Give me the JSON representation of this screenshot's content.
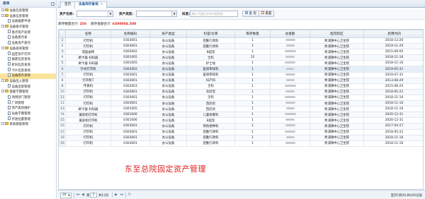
{
  "sidebar": {
    "title": "菜单",
    "items": [
      {
        "label": "设备信息管理",
        "level": 0,
        "type": "folder"
      },
      {
        "label": "设备信息管理",
        "level": 0,
        "type": "folder"
      },
      {
        "label": "设备报废申请",
        "level": 1,
        "type": "doc"
      },
      {
        "label": "设备盘点管理",
        "level": 0,
        "type": "folder"
      },
      {
        "label": "盘点资产处理",
        "level": 1,
        "type": "doc"
      },
      {
        "label": "设备盘点表",
        "level": 1,
        "type": "doc"
      },
      {
        "label": "设备资产盘点",
        "level": 1,
        "type": "doc"
      },
      {
        "label": "设备查询管理",
        "level": 0,
        "type": "folder"
      },
      {
        "label": "固定资产打印",
        "level": 1,
        "type": "doc"
      },
      {
        "label": "报废信息查询",
        "level": 1,
        "type": "doc"
      },
      {
        "label": "折旧信息查询",
        "level": 1,
        "type": "doc"
      },
      {
        "label": "卡片信息查询",
        "level": 1,
        "type": "doc"
      },
      {
        "label": "设备库存查询",
        "level": 1,
        "type": "doc",
        "selected": true
      },
      {
        "label": "设备出入管理",
        "level": 0,
        "type": "folder"
      },
      {
        "label": "设备出库管理",
        "level": 1,
        "type": "doc"
      },
      {
        "label": "基础字典管理",
        "level": 0,
        "type": "folder"
      },
      {
        "label": "领用部门管理",
        "level": 1,
        "type": "doc"
      },
      {
        "label": "厂商管理",
        "level": 1,
        "type": "doc"
      },
      {
        "label": "资产类别维护",
        "level": 1,
        "type": "doc"
      },
      {
        "label": "设备字典管理",
        "level": 1,
        "type": "doc"
      },
      {
        "label": "存放位置管理",
        "level": 1,
        "type": "doc"
      },
      {
        "label": "系统基础管理",
        "level": 0,
        "type": "folder"
      }
    ]
  },
  "tabs": [
    {
      "label": "首页",
      "active": false
    },
    {
      "label": "设备库存查询",
      "active": true,
      "close": "×"
    }
  ],
  "search": {
    "asset_name_label": "资产名称:",
    "asset_type_label": "资产类型:",
    "keyword_label": "科室:",
    "keyword_placeholder": "输入不超过字符内容搜索",
    "dropdown_arrow": "▼",
    "search_button": "查 询",
    "reset_button": "重置"
  },
  "stats": {
    "total_label": "库存数量合计:",
    "total_value": "256",
    "amount_label": "库存金额合计:",
    "amount_value": "6300004.580"
  },
  "table": {
    "columns": [
      "名称",
      "名称编码",
      "资产类型",
      "科室/仓库",
      "库存数量",
      "总金额",
      "医院院区",
      "启用时间"
    ],
    "rows": [
      [
        "打印机",
        "0303001",
        "办公设备",
        "后勤行政科",
        "1",
        "",
        "青浦镇中心卫生院",
        "2018-12-20"
      ],
      [
        "打印机",
        "0303001",
        "办公设备",
        "后勤行政科",
        "1",
        "",
        "青浦镇中心卫生院",
        "2019-11-29"
      ],
      [
        "电脑桌椅",
        "0302002",
        "办公设备",
        "B超室",
        "1",
        "",
        "青浦镇中心卫生院",
        "2015-09-05"
      ],
      [
        "刷卡器 扫码器",
        "0301005",
        "办公设备",
        "全科",
        "15",
        "",
        "青浦镇中心卫生院",
        "2018-11-16"
      ],
      [
        "刷卡器 扫码器",
        "0301005",
        "办公设备",
        "护士站",
        "1",
        "",
        "青浦镇中心卫生院",
        "2018-11-16"
      ],
      [
        "针式打印机",
        "0303002",
        "办公设备",
        "医保审核科",
        "1",
        "",
        "青浦镇中心卫生院",
        "2019-05-31"
      ],
      [
        "打印机",
        "0303001",
        "办公设备",
        "医保审核科",
        "1",
        "",
        "青浦镇中心卫生院",
        "2019-07-31"
      ],
      [
        "打印机T",
        "0303001",
        "办公设备",
        "妇产科",
        "1",
        "",
        "青浦镇中心卫生院",
        "2013-08-29"
      ],
      [
        "传真机",
        "0302003",
        "办公设备",
        "全科",
        "1",
        "",
        "青浦镇中心卫生院",
        "2015-08-25"
      ],
      [
        "打印机",
        "0303001",
        "办公设备",
        "化验室",
        "1",
        "",
        "青浦镇中心卫生院",
        "2018-05-22"
      ],
      [
        "打印机",
        "0303001",
        "办公设备",
        "全科",
        "1",
        "",
        "青浦镇中心卫生院",
        "2018-11-16"
      ],
      [
        "打印机",
        "0303001",
        "办公设备",
        "西药房",
        "1",
        "",
        "青浦镇中心卫生院",
        "2018-11-16"
      ],
      [
        "刷卡器 扫码器",
        "0301005",
        "办公设备",
        "西药房",
        "1",
        "",
        "青浦镇中心卫生院",
        "2018-11-16"
      ],
      [
        "兼容机打印机",
        "0301006",
        "办公设备",
        "儿童保健科",
        "1",
        "",
        "青浦镇中心卫生院",
        "2020-12-31"
      ],
      [
        "兼容机打印机",
        "0301006",
        "办公设备",
        "B超室",
        "1",
        "",
        "青浦镇中心卫生院",
        "2020-12-31"
      ],
      [
        "打印机",
        "0303001",
        "办公设备",
        "预防接种科",
        "1",
        "",
        "青浦镇中心卫生院",
        "2017-04-27"
      ],
      [
        "打印机",
        "0303001",
        "办公设备",
        "后勤行政科",
        "1",
        "",
        "青浦镇中心卫生院",
        "2018-05-22"
      ],
      [
        "打印机",
        "0303001",
        "办公设备",
        "后勤行政科",
        "1",
        "",
        "青浦镇中心卫生院",
        "2018-11-16"
      ],
      [
        "打印机",
        "0303001",
        "办公设备",
        "后勤行政科",
        "1",
        "",
        "青浦镇中心卫生院",
        "2018-11-16"
      ]
    ],
    "highlight_row": 5
  },
  "pager": {
    "page_size": "20",
    "first_icon": "⏮",
    "prev_icon": "◀",
    "page_prefix": "第",
    "page_value": "1",
    "page_suffix": "共13页",
    "next_icon": "▶",
    "last_icon": "⏭",
    "refresh_icon": "↻",
    "info": "显示1到20,共245记录"
  },
  "watermark": "东至总院固定资产管理",
  "colors": {
    "accent": "#1b5b9a",
    "highlight": "#fbe49a",
    "stat_red": "#e02020"
  }
}
